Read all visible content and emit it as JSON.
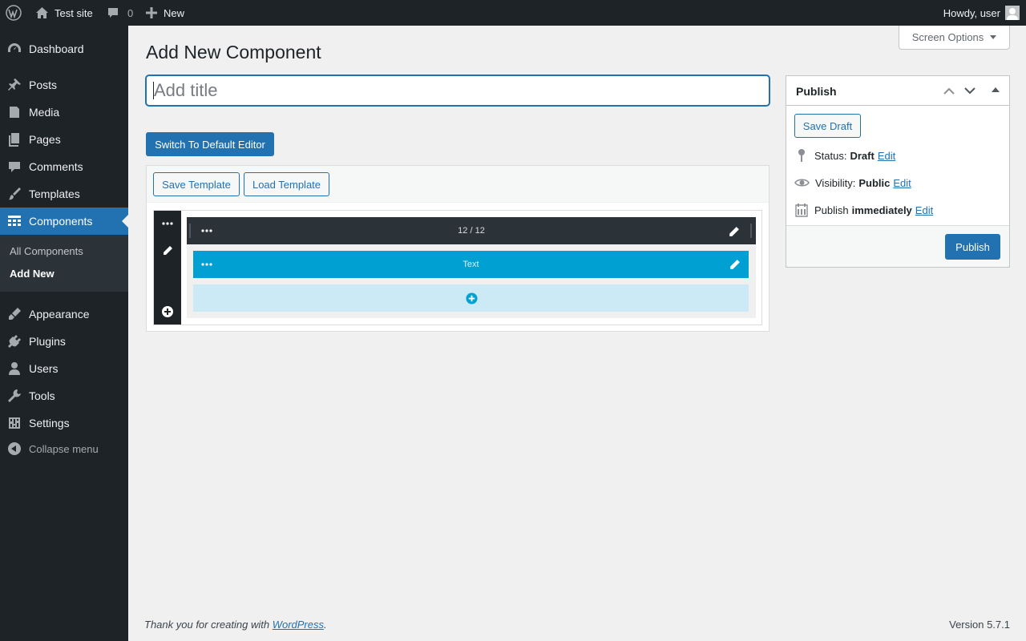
{
  "adminbar": {
    "site_name": "Test site",
    "comments_count": "0",
    "new_label": "New",
    "howdy": "Howdy, user"
  },
  "menu": {
    "items": [
      {
        "label": "Dashboard",
        "icon": "dashboard-icon"
      },
      {
        "label": "Posts",
        "icon": "pin-icon"
      },
      {
        "label": "Media",
        "icon": "media-icon"
      },
      {
        "label": "Pages",
        "icon": "pages-icon"
      },
      {
        "label": "Comments",
        "icon": "comment-icon"
      },
      {
        "label": "Templates",
        "icon": "brush-icon"
      },
      {
        "label": "Components",
        "icon": "table-icon"
      },
      {
        "label": "Appearance",
        "icon": "appearance-icon"
      },
      {
        "label": "Plugins",
        "icon": "plugin-icon"
      },
      {
        "label": "Users",
        "icon": "user-icon"
      },
      {
        "label": "Tools",
        "icon": "wrench-icon"
      },
      {
        "label": "Settings",
        "icon": "settings-icon"
      }
    ],
    "submenu": [
      "All Components",
      "Add New"
    ],
    "collapse": "Collapse menu"
  },
  "page": {
    "screen_options": "Screen Options",
    "title": "Add New Component",
    "title_placeholder": "Add title",
    "switch_editor": "Switch To Default Editor",
    "save_template": "Save Template",
    "load_template": "Load Template",
    "row_label": "12 / 12",
    "text_block_label": "Text"
  },
  "publish": {
    "title": "Publish",
    "save_draft": "Save Draft",
    "status_label": "Status:",
    "status_value": "Draft",
    "visibility_label": "Visibility:",
    "visibility_value": "Public",
    "schedule_label": "Publish",
    "schedule_value": "immediately",
    "edit_link": "Edit",
    "publish_button": "Publish"
  },
  "footer": {
    "thanks_prefix": "Thank you for creating with",
    "thanks_link": "WordPress",
    "thanks_suffix": ".",
    "version": "Version 5.7.1"
  },
  "colors": {
    "accent": "#2271b1",
    "admin_dark": "#1d2327",
    "builder_blue": "#00a0d2",
    "builder_light": "#cbeaf5"
  }
}
